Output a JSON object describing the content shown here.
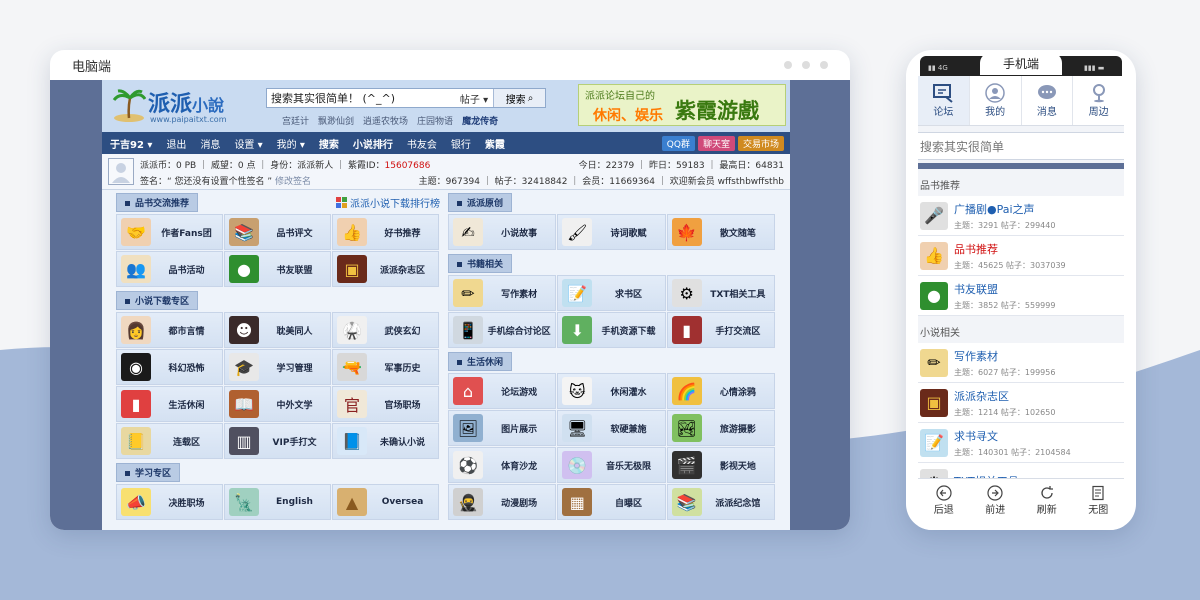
{
  "desktop": {
    "window_title": "电脑端",
    "logo": {
      "name": "派派",
      "name_small": "小說",
      "url": "www.paipaitxt.com"
    },
    "search": {
      "placeholder": "搜索其实很简单！ (^_^)",
      "type": "帖子",
      "button": "搜索"
    },
    "hot_links": [
      "宫廷计",
      "飘渺仙剑",
      "逍遥农牧场",
      "庄园物语",
      "魔龙传奇"
    ],
    "banner": {
      "line1": "派派论坛自己的",
      "line2": "休闲、娱乐",
      "line3": "紫霞游戲"
    },
    "nav": [
      "于吉92",
      "退出",
      "消息",
      "设置",
      "我的",
      "搜索",
      "小说排行",
      "书友会",
      "银行",
      "紫霞"
    ],
    "nav_buttons": [
      "QQ群",
      "聊天室",
      "交易市场"
    ],
    "user": {
      "row1": "派派币：0 PB ｜ 威望：0 点 ｜ 身份：派派新人 ｜ 紫霞ID：",
      "zixia_id": "15607686",
      "row2_sign": "签名：",
      "row2_text": "“ 您还没有设置个性签名 ”",
      "row2_edit": "修改签名",
      "stats1": "今日：22379 ｜ 昨日：59183 ｜ 最高日：64831",
      "stats2": "主题：967394 ｜ 帖子：32418842 ｜ 会员：11669364 ｜ 欢迎新会员 wffsthbwffsthb"
    },
    "rank_link": "派派小说下载排行榜",
    "left_sections": [
      {
        "title": "品书交流推荐",
        "items": [
          "作者Fans团",
          "品书评文",
          "好书推荐",
          "品书活动",
          "书友联盟",
          "派派杂志区"
        ]
      },
      {
        "title": "小说下载专区",
        "items": [
          "都市言情",
          "耽美同人",
          "武侠玄幻",
          "科幻恐怖",
          "学习管理",
          "军事历史",
          "生活休闲",
          "中外文学",
          "官场职场",
          "连载区",
          "VIP手打文",
          "未确认小说"
        ]
      },
      {
        "title": "学习专区",
        "items": [
          "决胜职场",
          "English",
          "Oversea"
        ]
      }
    ],
    "right_sections": [
      {
        "title": "派派原创",
        "items": [
          "小说故事",
          "诗词歌赋",
          "散文随笔"
        ]
      },
      {
        "title": "书籍相关",
        "items": [
          "写作素材",
          "求书区",
          "TXT相关工具",
          "手机综合讨论区",
          "手机资源下载",
          "手打交流区"
        ]
      },
      {
        "title": "生活休闲",
        "items": [
          "论坛游戏",
          "休闲灌水",
          "心情涂鸦",
          "图片展示",
          "软硬兼施",
          "旅游摄影",
          "体育沙龙",
          "音乐无极限",
          "影视天地",
          "动漫剧场",
          "自曝区",
          "派派纪念馆"
        ]
      }
    ],
    "colors": {
      "navbar": "#2d4e82",
      "frame": "#5d6f96",
      "accent_red": "#d01010"
    }
  },
  "mobile": {
    "window_title": "手机端",
    "status_left": "▮▮ 4G",
    "status_right": "▮▮▮ ▬",
    "nav": [
      "论坛",
      "我的",
      "消息",
      "周边"
    ],
    "search_placeholder": "搜索其实很简单",
    "sections": [
      {
        "title": "品书推荐",
        "items": [
          {
            "name": "广播剧●Pai之声",
            "stats": "主题：3291  帖子：299440"
          },
          {
            "name": "品书推荐",
            "stats": "主题：45625  帖子：3037039"
          },
          {
            "name": "书友联盟",
            "stats": "主题：3852  帖子：559999"
          }
        ]
      },
      {
        "title": "小说相关",
        "items": [
          {
            "name": "写作素材",
            "stats": "主题：6027  帖子：199956"
          },
          {
            "name": "派派杂志区",
            "stats": "主题：1214  帖子：102650"
          },
          {
            "name": "求书寻文",
            "stats": "主题：140301  帖子：2104584"
          },
          {
            "name": "TXT相关工具",
            "stats": ""
          }
        ]
      }
    ],
    "bottom_bar": [
      "后退",
      "前进",
      "刷新",
      "无图"
    ]
  }
}
